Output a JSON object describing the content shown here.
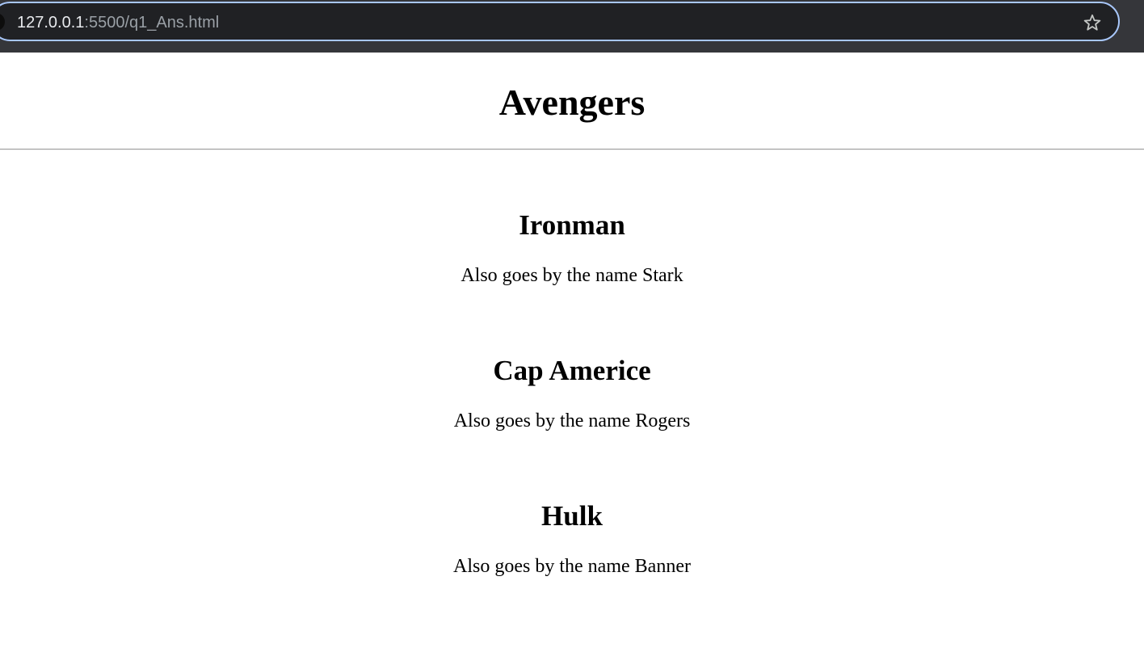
{
  "browser": {
    "url_host": "127.0.0.1",
    "url_path": ":5500/q1_Ans.html",
    "icons": [
      "site-info-icon",
      "bookmark-star-icon"
    ]
  },
  "page": {
    "title": "Avengers",
    "heroes": [
      {
        "name": "Ironman",
        "alias": "Also goes by the name Stark"
      },
      {
        "name": "Cap Americe",
        "alias": "Also goes by the name Rogers"
      },
      {
        "name": "Hulk",
        "alias": "Also goes by the name Banner"
      }
    ]
  },
  "colors": {
    "toolbar": "#35363a",
    "omnibox": "#202124",
    "focus_ring": "#a8c7fa",
    "page_background": "#ffffff",
    "text": "#000000"
  }
}
